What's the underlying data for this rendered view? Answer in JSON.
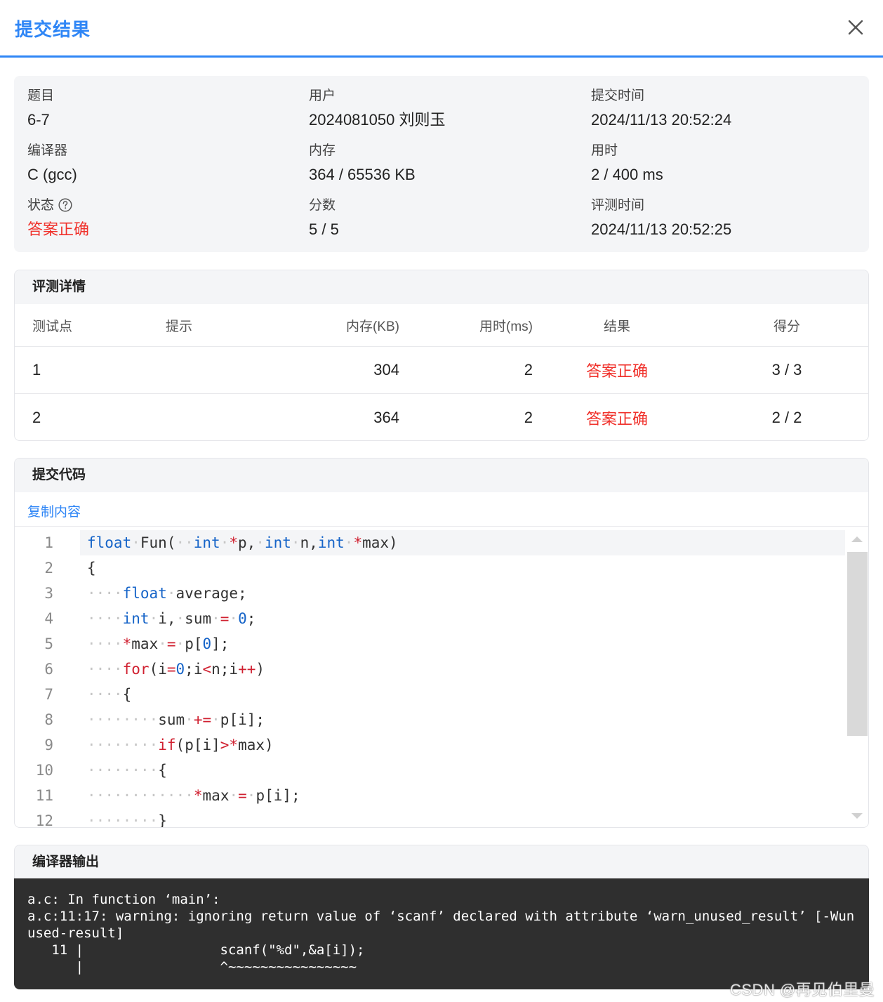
{
  "dialog": {
    "title": "提交结果"
  },
  "info": {
    "problem": {
      "label": "题目",
      "value": "6-7"
    },
    "user": {
      "label": "用户",
      "value": "2024081050 刘则玉"
    },
    "submit_time": {
      "label": "提交时间",
      "value": "2024/11/13 20:52:24"
    },
    "compiler": {
      "label": "编译器",
      "value": "C (gcc)"
    },
    "memory": {
      "label": "内存",
      "value": "364 / 65536 KB"
    },
    "time_used": {
      "label": "用时",
      "value": "2 / 400 ms"
    },
    "status": {
      "label": "状态",
      "value": "答案正确"
    },
    "score": {
      "label": "分数",
      "value": "5 / 5"
    },
    "judge_time": {
      "label": "评测时间",
      "value": "2024/11/13 20:52:25"
    }
  },
  "judge_details": {
    "title": "评测详情",
    "columns": [
      "测试点",
      "提示",
      "内存(KB)",
      "用时(ms)",
      "结果",
      "得分"
    ],
    "rows": [
      {
        "id": "1",
        "hint": "",
        "memory": "304",
        "time": "2",
        "result": "答案正确",
        "score": "3 / 3"
      },
      {
        "id": "2",
        "hint": "",
        "memory": "364",
        "time": "2",
        "result": "答案正确",
        "score": "2 / 2"
      }
    ]
  },
  "code_panel": {
    "title": "提交代码",
    "copy_label": "复制内容",
    "line_numbers": [
      "1",
      "2",
      "3",
      "4",
      "5",
      "6",
      "7",
      "8",
      "9",
      "10",
      "11",
      "12"
    ],
    "lines": [
      "float Fun(  int *p, int n,int *max)",
      "{",
      "    float average;",
      "    int i, sum = 0;",
      "    *max = p[0];",
      "    for(i=0;i<n;i++)",
      "    {",
      "        sum += p[i];",
      "        if(p[i]>*max)",
      "        {",
      "            *max = p[i];",
      "        }"
    ]
  },
  "compiler_output": {
    "title": "编译器输出",
    "text": "a.c: In function ‘main’:\na.c:11:17: warning: ignoring return value of ‘scanf’ declared with attribute ‘warn_unused_result’ [-Wunused-result]\n   11 |                 scanf(\"%d\",&a[i]);\n      |                 ^~~~~~~~~~~~~~~~~"
  },
  "watermark": "CSDN @再见伯里曼",
  "colors": {
    "accent": "#2f86f6",
    "success_text": "#f0302a",
    "terminal_bg": "#2f2f2f"
  }
}
